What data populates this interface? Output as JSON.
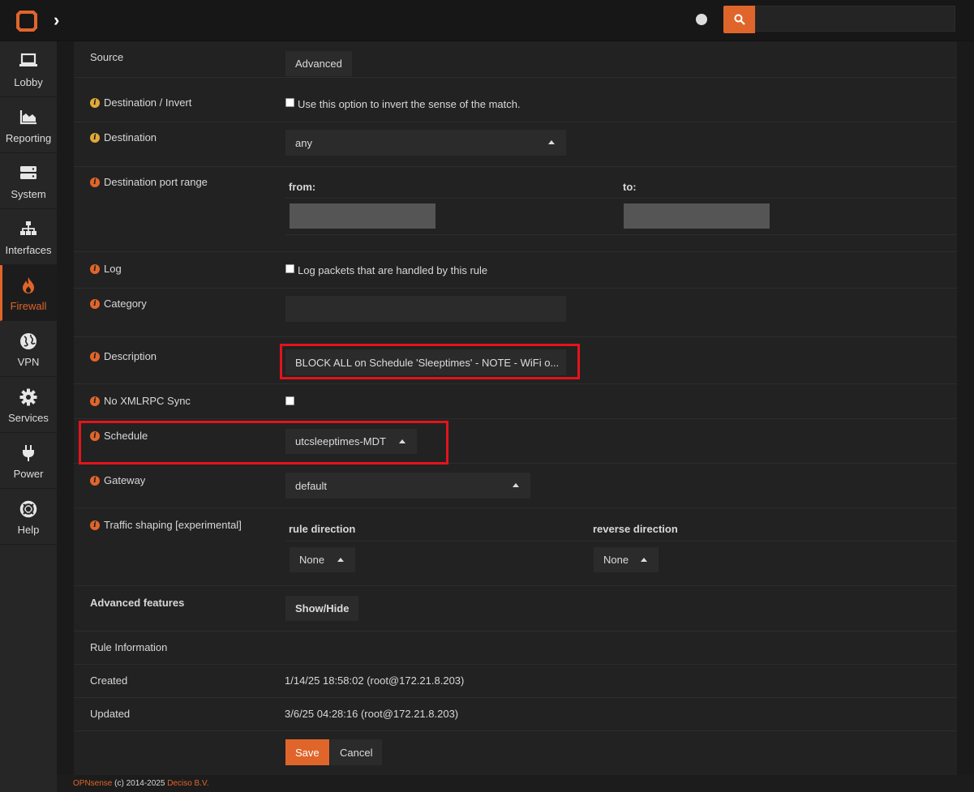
{
  "topbar": {
    "search_placeholder": ""
  },
  "sidebar": {
    "items": [
      {
        "label": "Lobby",
        "icon": "laptop-icon"
      },
      {
        "label": "Reporting",
        "icon": "area-chart-icon"
      },
      {
        "label": "System",
        "icon": "server-icon"
      },
      {
        "label": "Interfaces",
        "icon": "sitemap-icon"
      },
      {
        "label": "Firewall",
        "icon": "fire-icon",
        "active": true
      },
      {
        "label": "VPN",
        "icon": "globe-icon"
      },
      {
        "label": "Services",
        "icon": "gear-icon"
      },
      {
        "label": "Power",
        "icon": "plug-icon"
      },
      {
        "label": "Help",
        "icon": "lifebuoy-icon"
      }
    ]
  },
  "form": {
    "source": {
      "label": "Source",
      "button": "Advanced"
    },
    "destination_invert": {
      "label": "Destination / Invert",
      "checkbox_text": "Use this option to invert the sense of the match."
    },
    "destination": {
      "label": "Destination",
      "value": "any"
    },
    "destination_port_range": {
      "label": "Destination port range",
      "from_label": "from:",
      "to_label": "to:"
    },
    "log": {
      "label": "Log",
      "checkbox_text": "Log packets that are handled by this rule"
    },
    "category": {
      "label": "Category",
      "value": ""
    },
    "description": {
      "label": "Description",
      "value": "BLOCK ALL on Schedule 'Sleeptimes' - NOTE - WiFi o..."
    },
    "no_xmlrpc_sync": {
      "label": "No XMLRPC Sync"
    },
    "schedule": {
      "label": "Schedule",
      "value": "utcsleeptimes-MDT"
    },
    "gateway": {
      "label": "Gateway",
      "value": "default"
    },
    "traffic_shaping": {
      "label": "Traffic shaping [experimental]",
      "rule_direction_label": "rule direction",
      "rule_direction_value": "None",
      "reverse_direction_label": "reverse direction",
      "reverse_direction_value": "None"
    },
    "advanced_features": {
      "label": "Advanced features",
      "button": "Show/Hide"
    },
    "rule_information": {
      "label": "Rule Information"
    },
    "created": {
      "label": "Created",
      "value": "1/14/25 18:58:02 (root@172.21.8.203)"
    },
    "updated": {
      "label": "Updated",
      "value": "3/6/25 04:28:16 (root@172.21.8.203)"
    },
    "save_button": "Save",
    "cancel_button": "Cancel"
  },
  "footer": {
    "brand": "OPNsense",
    "copyright": "(c) 2014-2025",
    "company": "Deciso B.V."
  },
  "colors": {
    "accent": "#e0652b",
    "highlight": "#e3141b",
    "info_yellow": "#e0a93a"
  }
}
